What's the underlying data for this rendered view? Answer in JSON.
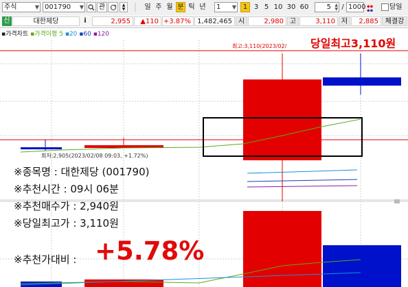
{
  "toolbar": {
    "market": "주식",
    "code": "001790",
    "gwan_label": "관",
    "periods": [
      "일",
      "주",
      "월",
      "분",
      "틱",
      "년"
    ],
    "active_period": "분",
    "interval_value": "1",
    "minute_presets": [
      "1",
      "3",
      "5",
      "10",
      "30",
      "60"
    ],
    "step_value": "5",
    "count_value": "1000",
    "same_day_label": "당일"
  },
  "infobar": {
    "sin": "신",
    "name": "대한제당",
    "info": "i",
    "price": "2,955",
    "change": "▲110",
    "change_pct": "+3.87%",
    "volume": "1,482,465",
    "open_label": "시",
    "open": "2,980",
    "high_label": "고",
    "high": "3,110",
    "low_label": "저",
    "low": "2,885",
    "trade_button": "체결강"
  },
  "legend": {
    "chart_label": "가격차트",
    "ma_label": "가격이평",
    "ma_periods": [
      "5",
      "20",
      "60",
      "120"
    ]
  },
  "chart_labels": {
    "max_price_text": "최고:3,110(2023/02/",
    "min_price_text": "최저:2,905(2023/02/08 09:03, +1.72%)"
  },
  "overlay": {
    "stock_line": "※종목명 : 대한제당 (001790)",
    "time_line": "※추천시간 : 09시 06분",
    "buy_price_line": "※추천매수가 : 2,940원",
    "high_price_line": "※당일최고가 : 3,110원",
    "ratio_label": "※추천가대비 :",
    "ratio_value": "+5.78%",
    "high_callout": "당일최고3,110원"
  },
  "colors": {
    "up": "#e30000",
    "down": "#0011cc",
    "ma5": "#5aaa1a",
    "ma20": "#1a8fd8",
    "ma60": "#1a3fb0",
    "ma120": "#8a1aa0"
  }
}
